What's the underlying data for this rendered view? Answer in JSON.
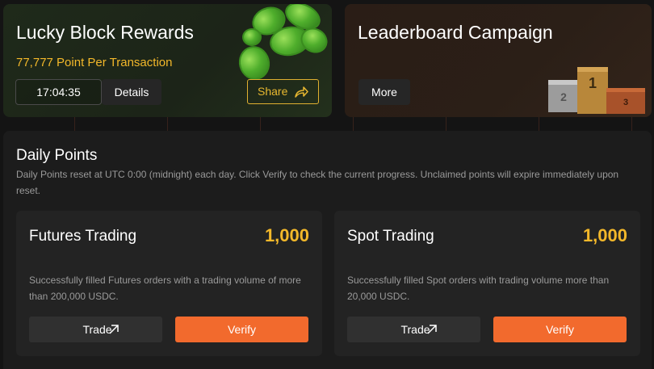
{
  "lucky_block": {
    "title": "Lucky Block Rewards",
    "point_rate": "77,777 Point Per Transaction",
    "timer": "17:04:35",
    "details_label": "Details",
    "share_label": "Share"
  },
  "leaderboard": {
    "title": "Leaderboard Campaign",
    "more_label": "More",
    "podium": {
      "first": "1",
      "second": "2",
      "third": "3"
    }
  },
  "daily_points": {
    "title": "Daily Points",
    "description": "Daily Points reset at UTC 0:00 (midnight) each day. Click Verify to check the current progress. Unclaimed points will expire immediately upon reset.",
    "tasks": [
      {
        "name": "Futures Trading",
        "points": "1,000",
        "description": "Successfully filled Futures orders with a trading volume of more than 200,000 USDC.",
        "trade_label": "Trade",
        "verify_label": "Verify"
      },
      {
        "name": "Spot Trading",
        "points": "1,000",
        "description": "Successfully filled Spot orders with trading volume more than 20,000 USDC.",
        "trade_label": "Trade",
        "verify_label": "Verify"
      }
    ]
  },
  "colors": {
    "accent_gold": "#f3b82a",
    "verify_orange": "#f26a2d",
    "background": "#141414"
  }
}
